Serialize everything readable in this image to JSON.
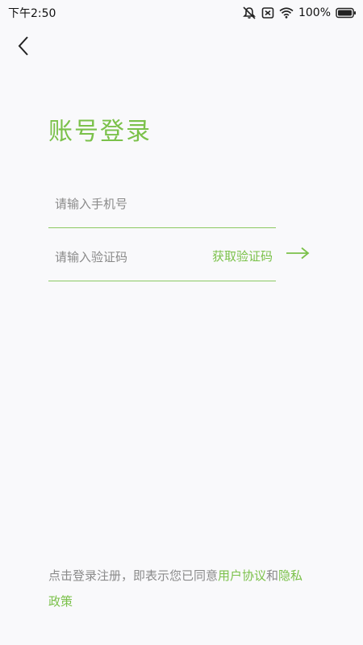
{
  "status_bar": {
    "time": "下午2:50",
    "battery": "100%",
    "icons": [
      "mute-icon",
      "sim-off-icon",
      "wifi-icon",
      "battery-icon"
    ]
  },
  "header": {
    "back_icon": "chevron-left-icon"
  },
  "main": {
    "title": "账号登录",
    "phone_placeholder": "请输入手机号",
    "phone_value": "",
    "code_placeholder": "请输入验证码",
    "code_value": "",
    "get_code_label": "获取验证码",
    "submit_icon": "arrow-right-icon"
  },
  "agreement": {
    "prefix": "点击登录注册，即表示您已同意",
    "user_agreement": "用户协议",
    "conjunction": "和",
    "privacy_policy": "隐私政策"
  },
  "colors": {
    "accent": "#7bc14a",
    "background": "#f9f9fb",
    "muted_text": "#8a8a8a"
  }
}
